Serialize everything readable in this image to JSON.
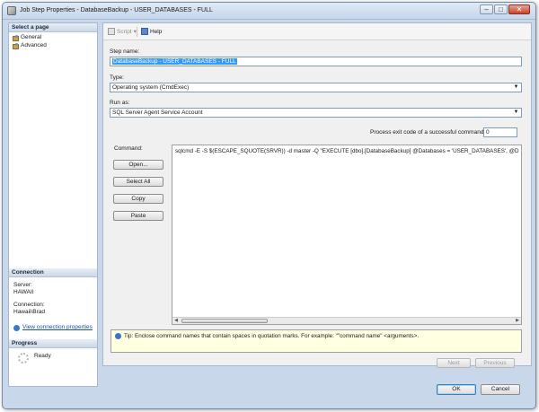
{
  "window": {
    "title": "Job Step Properties - DatabaseBackup - USER_DATABASES - FULL",
    "minimize": "–",
    "maximize": "□",
    "close": "✕"
  },
  "left_pane": {
    "select_page_header": "Select a page",
    "pages": [
      "General",
      "Advanced"
    ],
    "connection_header": "Connection",
    "server_label": "Server:",
    "server_value": "HAWAII",
    "connection_label": "Connection:",
    "connection_value": "Hawaii\\Brad",
    "view_connection_link": "View connection properties",
    "progress_header": "Progress",
    "progress_status": "Ready"
  },
  "toolbar": {
    "script_label": "Script",
    "script_dropdown": "▾",
    "help_label": "Help"
  },
  "form": {
    "step_name_label": "Step name:",
    "step_name_value": "DatabaseBackup - USER_DATABASES - FULL",
    "type_label": "Type:",
    "type_value": "Operating system (CmdExec)",
    "run_as_label": "Run as:",
    "run_as_value": "SQL Server Agent Service Account",
    "exit_code_label": "Process exit code of a successful command:",
    "exit_code_value": "0",
    "command_label": "Command:",
    "command_text": "sqlcmd -E -S $(ESCAPE_SQUOTE(SRVR)) -d master -Q \"EXECUTE [dbo].[DatabaseBackup] @Databases = 'USER_DATABASES', @D",
    "buttons": {
      "open": "Open...",
      "select_all": "Select All",
      "copy": "Copy",
      "paste": "Paste"
    },
    "tip_text": "Tip: Enclose command names that contain spaces in quotation marks. For example: \"\"command name\" <arguments>."
  },
  "nav": {
    "next": "Next",
    "previous": "Previous"
  },
  "footer": {
    "ok": "OK",
    "cancel": "Cancel"
  },
  "icons": {
    "combo_arrow": "▼",
    "scroll_left": "◀",
    "scroll_right": "▶"
  }
}
